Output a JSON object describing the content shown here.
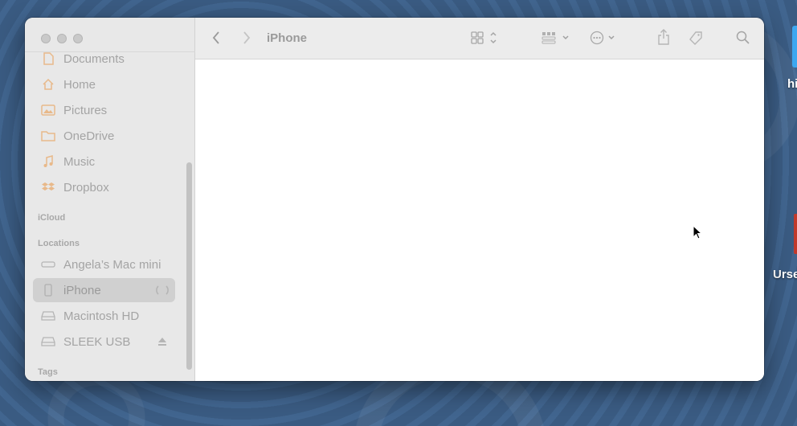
{
  "toolbar": {
    "title": "iPhone"
  },
  "sidebar": {
    "items_top": [
      {
        "label": "Documents",
        "icon": "document-icon"
      },
      {
        "label": "Home",
        "icon": "home-icon"
      },
      {
        "label": "Pictures",
        "icon": "pictures-icon"
      },
      {
        "label": "OneDrive",
        "icon": "folder-icon"
      },
      {
        "label": "Music",
        "icon": "music-icon"
      },
      {
        "label": "Dropbox",
        "icon": "dropbox-icon"
      }
    ],
    "icloud_header": "iCloud",
    "locations_header": "Locations",
    "locations": [
      {
        "label": "Angela’s Mac mini",
        "icon": "mac-mini-icon"
      },
      {
        "label": "iPhone",
        "icon": "iphone-icon"
      },
      {
        "label": "Macintosh HD",
        "icon": "drive-icon"
      },
      {
        "label": "SLEEK USB",
        "icon": "drive-icon"
      }
    ],
    "tags_header": "Tags"
  },
  "desktop": {
    "icon1_label": "hi",
    "icon2_label": "Urse"
  },
  "colors": {
    "accent_icon": "#e8b98a",
    "sidebar_bg": "#e8e8e8",
    "selected_bg": "#d0d0d0",
    "desktop_bg": "#3d5f86"
  }
}
